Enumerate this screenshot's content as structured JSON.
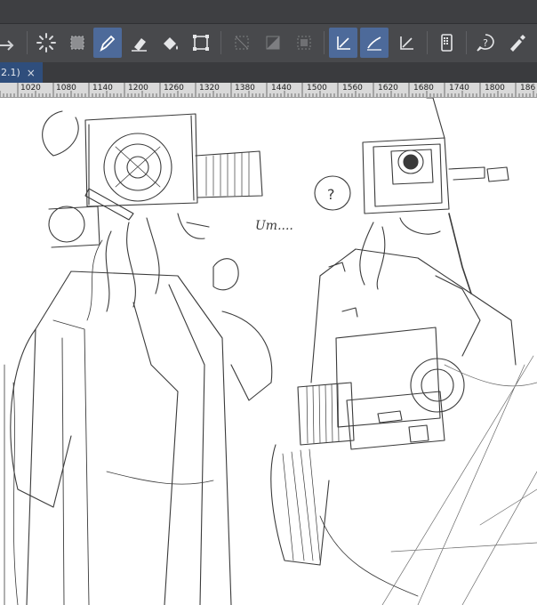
{
  "tab": {
    "label": "2.1)",
    "close": "×"
  },
  "ruler": {
    "labels": [
      "1020",
      "1080",
      "1140",
      "1200",
      "1260",
      "1320",
      "1380",
      "1440",
      "1500",
      "1560",
      "1620",
      "1680",
      "1740",
      "1800",
      "186"
    ]
  },
  "toolbar": {
    "icons": [
      "redo-icon",
      "loading-icon",
      "transform-icon",
      "pen-icon",
      "eraser-icon",
      "fill-icon",
      "select-transform-icon",
      "deselect-icon",
      "clear-icon",
      "show-selection-icon",
      "correct-line-icon",
      "smooth-line-icon",
      "ruler-tool-icon",
      "smartphone-icon",
      "help-icon",
      "settings-pen-icon"
    ],
    "active": [
      "pen-icon",
      "correct-line-icon",
      "smooth-line-icon"
    ]
  },
  "sketch": {
    "annotation": "Um....",
    "bubble": "?"
  }
}
